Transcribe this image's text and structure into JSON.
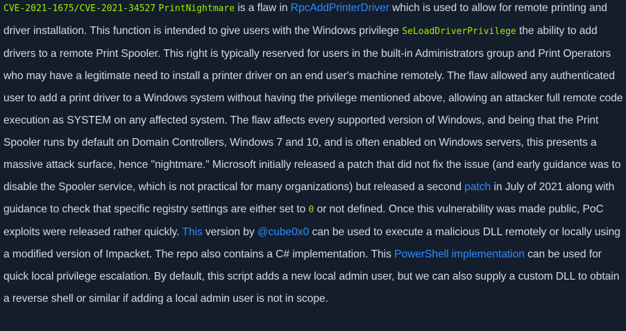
{
  "paragraph": {
    "cve_code": "CVE-2021-1675/CVE-2021-34527",
    "name_code": "PrintNightmare",
    "t1": " is a flaw in ",
    "link_rpc": "RpcAddPrinterDriver",
    "t2": " which is used to allow for remote printing and driver installation. This function is intended to give users with the Windows privilege ",
    "privilege_code": "SeLoadDriverPrivilege",
    "t3": " the ability to add drivers to a remote Print Spooler. This right is typically reserved for users in the built-in Administrators group and Print Operators who may have a legitimate need to install a printer driver on an end user's machine remotely. The flaw allowed any authenticated user to add a print driver to a Windows system without having the privilege mentioned above, allowing an attacker full remote code execution as SYSTEM on any affected system. The flaw affects every supported version of Windows, and being that the Print Spooler runs by default on Domain Controllers, Windows 7 and 10, and is often enabled on Windows servers, this presents a massive attack surface, hence \"nightmare.\" Microsoft initially released a patch that did not fix the issue (and early guidance was to disable the Spooler service, which is not practical for many organizations) but released a second ",
    "link_patch": "patch",
    "t4": " in July of 2021 along with guidance to check that specific registry settings are either set to ",
    "zero_code": "0",
    "t5": " or not defined. Once this vulnerability was made public, PoC exploits were released rather quickly. ",
    "link_this": "This",
    "t6": " version by ",
    "link_cube": "@cube0x0",
    "t7": " can be used to execute a malicious DLL remotely or locally using a modified version of Impacket. The repo also contains a C# implementation. This ",
    "link_ps": "PowerShell implementation",
    "t8": " can be used for quick local privilege escalation. By default, this script adds a new local admin user, but we can also supply a custom DLL to obtain a reverse shell or similar if adding a local admin user is not in scope."
  },
  "colors": {
    "background": "#141d2b",
    "text": "#d6dbe3",
    "code": "#9fef00",
    "link": "#2f8cff"
  }
}
